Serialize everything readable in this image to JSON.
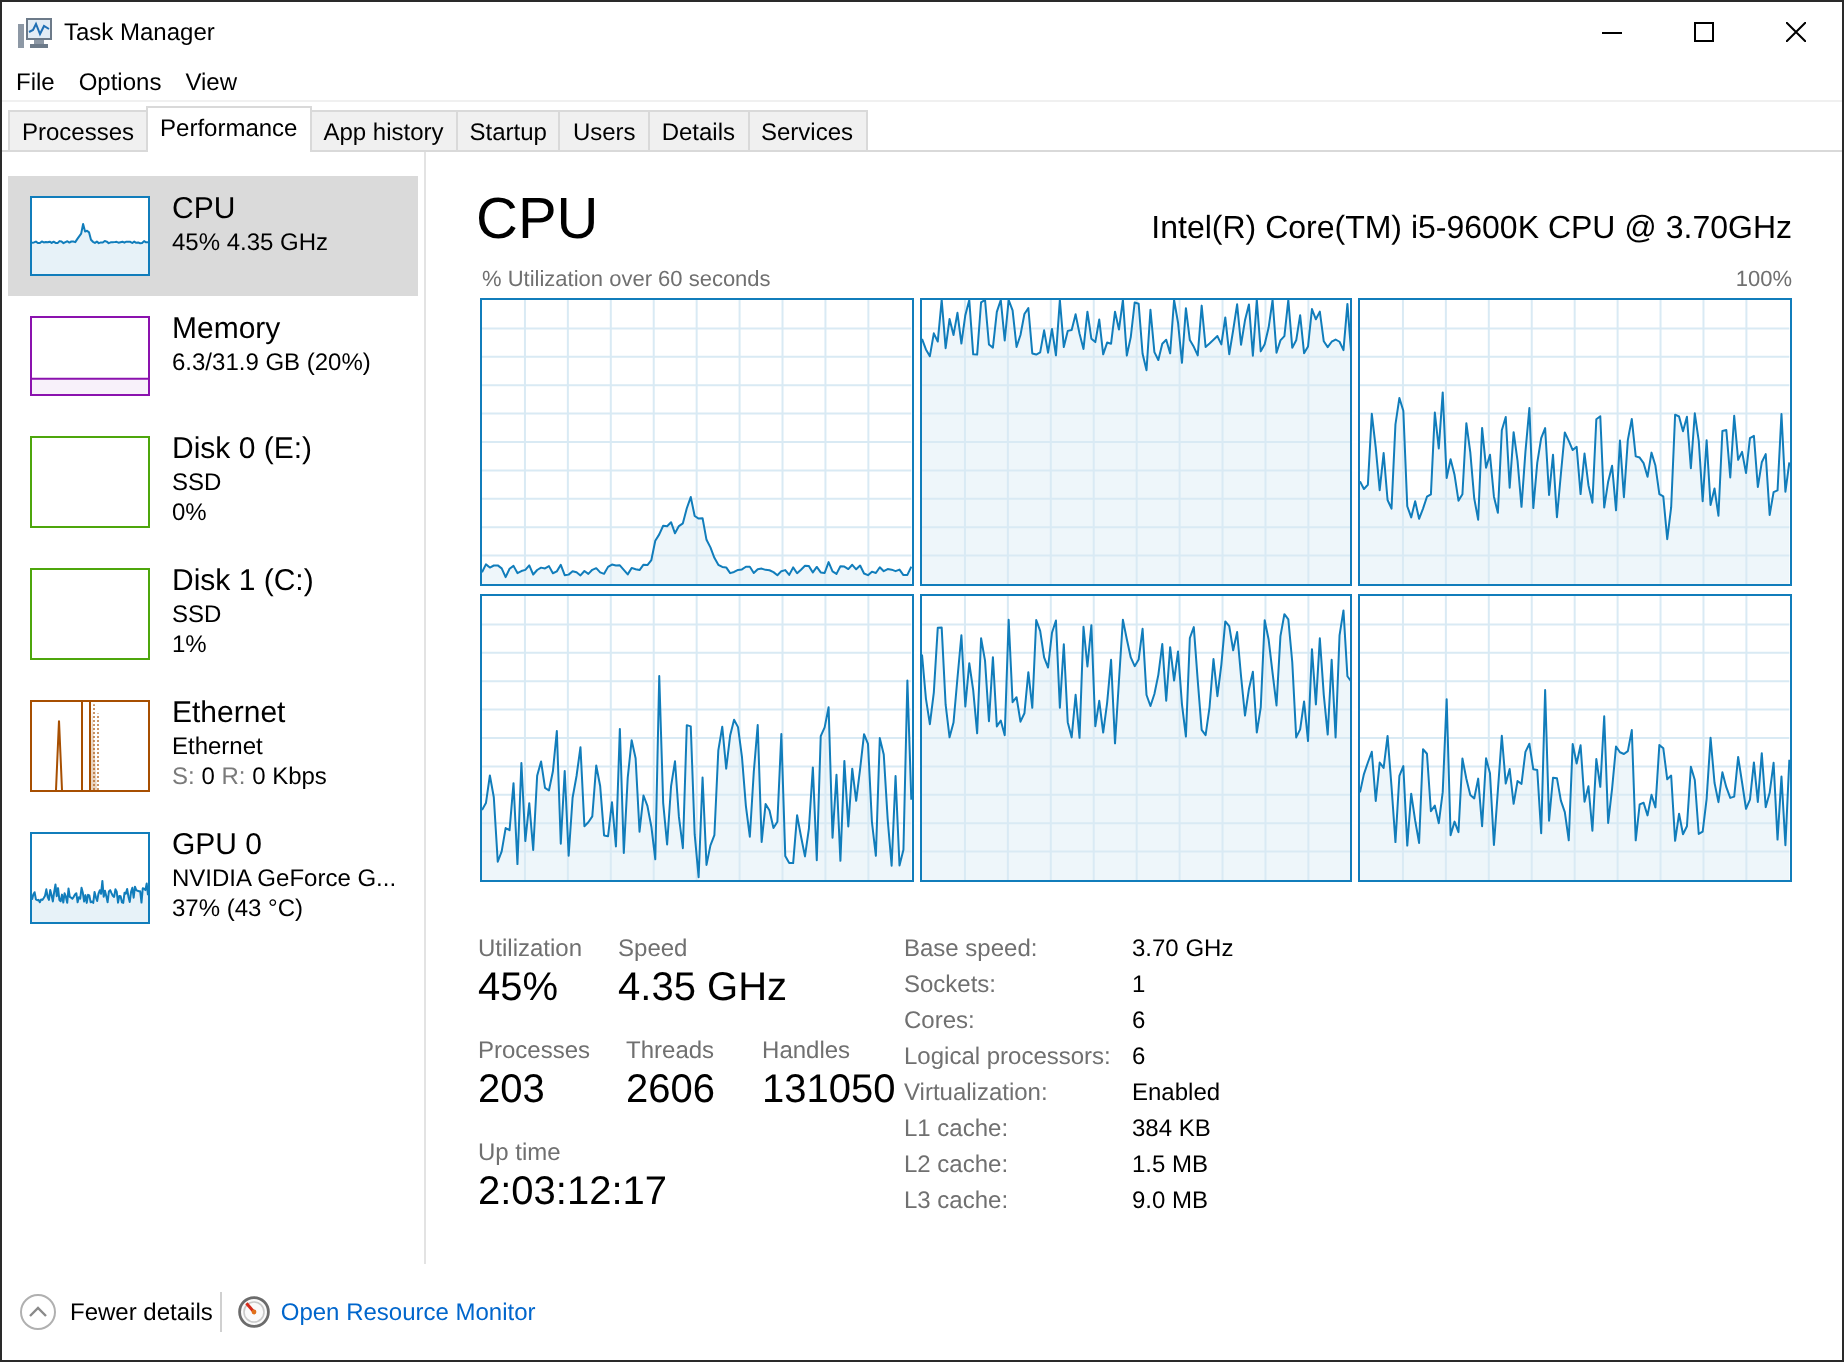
{
  "window": {
    "title": "Task Manager"
  },
  "menu": [
    "File",
    "Options",
    "View"
  ],
  "tabs": [
    {
      "label": "Processes",
      "selected": false
    },
    {
      "label": "Performance",
      "selected": true
    },
    {
      "label": "App history",
      "selected": false
    },
    {
      "label": "Startup",
      "selected": false
    },
    {
      "label": "Users",
      "selected": false
    },
    {
      "label": "Details",
      "selected": false
    },
    {
      "label": "Services",
      "selected": false
    }
  ],
  "sidebar": {
    "items": [
      {
        "title": "CPU",
        "kind": "cpu",
        "color": "#117dbb",
        "selected": true,
        "lines": [
          "45% 4.35 GHz"
        ]
      },
      {
        "title": "Memory",
        "kind": "memory",
        "color": "#8b12ae",
        "selected": false,
        "lines": [
          "6.3/31.9 GB (20%)"
        ]
      },
      {
        "title": "Disk 0 (E:)",
        "kind": "disk",
        "color": "#4da60c",
        "selected": false,
        "lines": [
          "SSD",
          "0%"
        ]
      },
      {
        "title": "Disk 1 (C:)",
        "kind": "disk",
        "color": "#4da60c",
        "selected": false,
        "lines": [
          "SSD",
          "1%"
        ]
      },
      {
        "title": "Ethernet",
        "kind": "network",
        "color": "#a74f01",
        "selected": false,
        "lines": [
          "Ethernet"
        ],
        "throughput": {
          "send_label": "S:",
          "send": "0",
          "receive_label": "R:",
          "receive": "0 Kbps"
        }
      },
      {
        "title": "GPU 0",
        "kind": "gpu",
        "color": "#117dbb",
        "selected": false,
        "lines": [
          "NVIDIA GeForce G...",
          "37% (43 °C)"
        ]
      }
    ]
  },
  "detail": {
    "title": "CPU",
    "model": "Intel(R) Core(TM) i5-9600K CPU @ 3.70GHz",
    "graph_caption": "% Utilization over 60 seconds",
    "graph_max": "100%",
    "stat_rows": [
      [
        {
          "label": "Utilization",
          "value": "45%"
        },
        {
          "label": "Speed",
          "value": "4.35 GHz"
        }
      ],
      [
        {
          "label": "Processes",
          "value": "203"
        },
        {
          "label": "Threads",
          "value": "2606"
        },
        {
          "label": "Handles",
          "value": "131050"
        }
      ],
      [
        {
          "label": "Up time",
          "value": "2:03:12:17"
        }
      ]
    ],
    "specs": [
      {
        "label": "Base speed:",
        "value": "3.70 GHz"
      },
      {
        "label": "Sockets:",
        "value": "1"
      },
      {
        "label": "Cores:",
        "value": "6"
      },
      {
        "label": "Logical processors:",
        "value": "6"
      },
      {
        "label": "Virtualization:",
        "value": "Enabled"
      },
      {
        "label": "L1 cache:",
        "value": "384 KB"
      },
      {
        "label": "L2 cache:",
        "value": "1.5 MB"
      },
      {
        "label": "L3 cache:",
        "value": "9.0 MB"
      }
    ]
  },
  "footer": {
    "toggle": "Fewer details",
    "link": "Open Resource Monitor"
  }
}
